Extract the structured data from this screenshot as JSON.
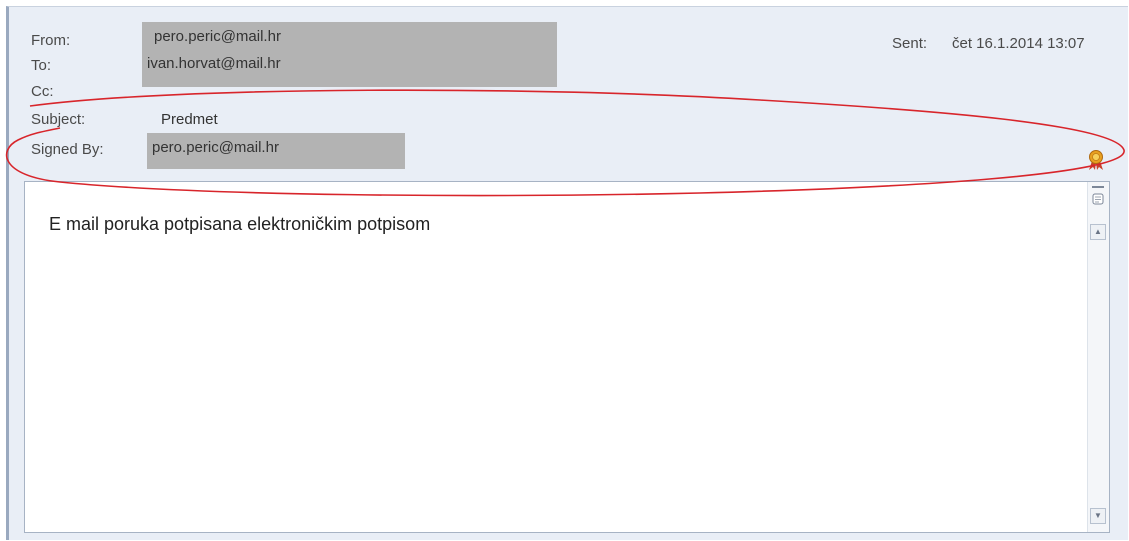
{
  "header": {
    "from_label": "From:",
    "from_value": "pero.peric@mail.hr",
    "to_label": "To:",
    "to_value": "ivan.horvat@mail.hr",
    "cc_label": "Cc:",
    "cc_value": "",
    "subject_label": "Subject:",
    "subject_value": "Predmet",
    "signed_by_label": "Signed By:",
    "signed_by_value": "pero.peric@mail.hr",
    "sent_label": "Sent:",
    "sent_value": "čet 16.1.2014 13:07"
  },
  "message": {
    "body": "E mail poruka potpisana elektroničkim potpisom"
  },
  "icons": {
    "signature": "certificate-ribbon-icon",
    "pane_toggle": "pane-toggle-icon",
    "scroll_up": "scroll-up-arrow-icon",
    "scroll_down": "scroll-down-arrow-icon"
  },
  "colors": {
    "header_bg": "#e9eef6",
    "redaction_gray": "#b3b3b3",
    "annotation_red": "#d8252b",
    "cert_icon_red": "#c8402a",
    "cert_icon_gold": "#e8a020"
  }
}
